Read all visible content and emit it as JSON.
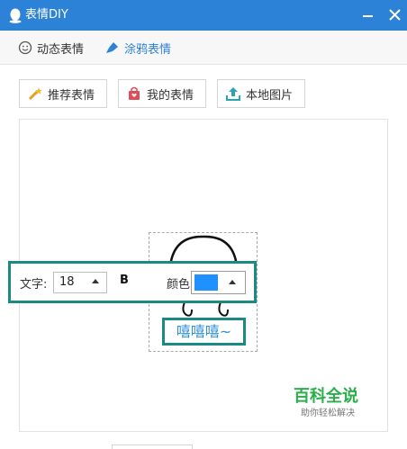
{
  "window": {
    "title": "表情DIY",
    "app_icon": "penguin-icon",
    "controls": [
      "minimize-icon",
      "close-icon"
    ]
  },
  "tabs": [
    {
      "label": "动态表情",
      "icon": "smiley-icon",
      "active": false
    },
    {
      "label": "涂鸦表情",
      "icon": "brush-icon",
      "active": true
    }
  ],
  "toolbar": {
    "recommend_label": "推荐表情",
    "mine_label": "我的表情",
    "local_label": "本地图片"
  },
  "text_toolbar": {
    "text_label": "文字:",
    "font_size": "18",
    "bold_label": "B",
    "color_label": "颜色:",
    "color_value": "#1e90ff"
  },
  "canvas": {
    "text": "嘻嘻嘻~"
  },
  "watermark": {
    "title": "百科全说",
    "subtitle": "助你轻松解决"
  },
  "colors": {
    "titlebar": "#2c82d6",
    "accent": "#2c82d6",
    "highlight": "#1a8a82",
    "watermark": "#2aae4a"
  }
}
